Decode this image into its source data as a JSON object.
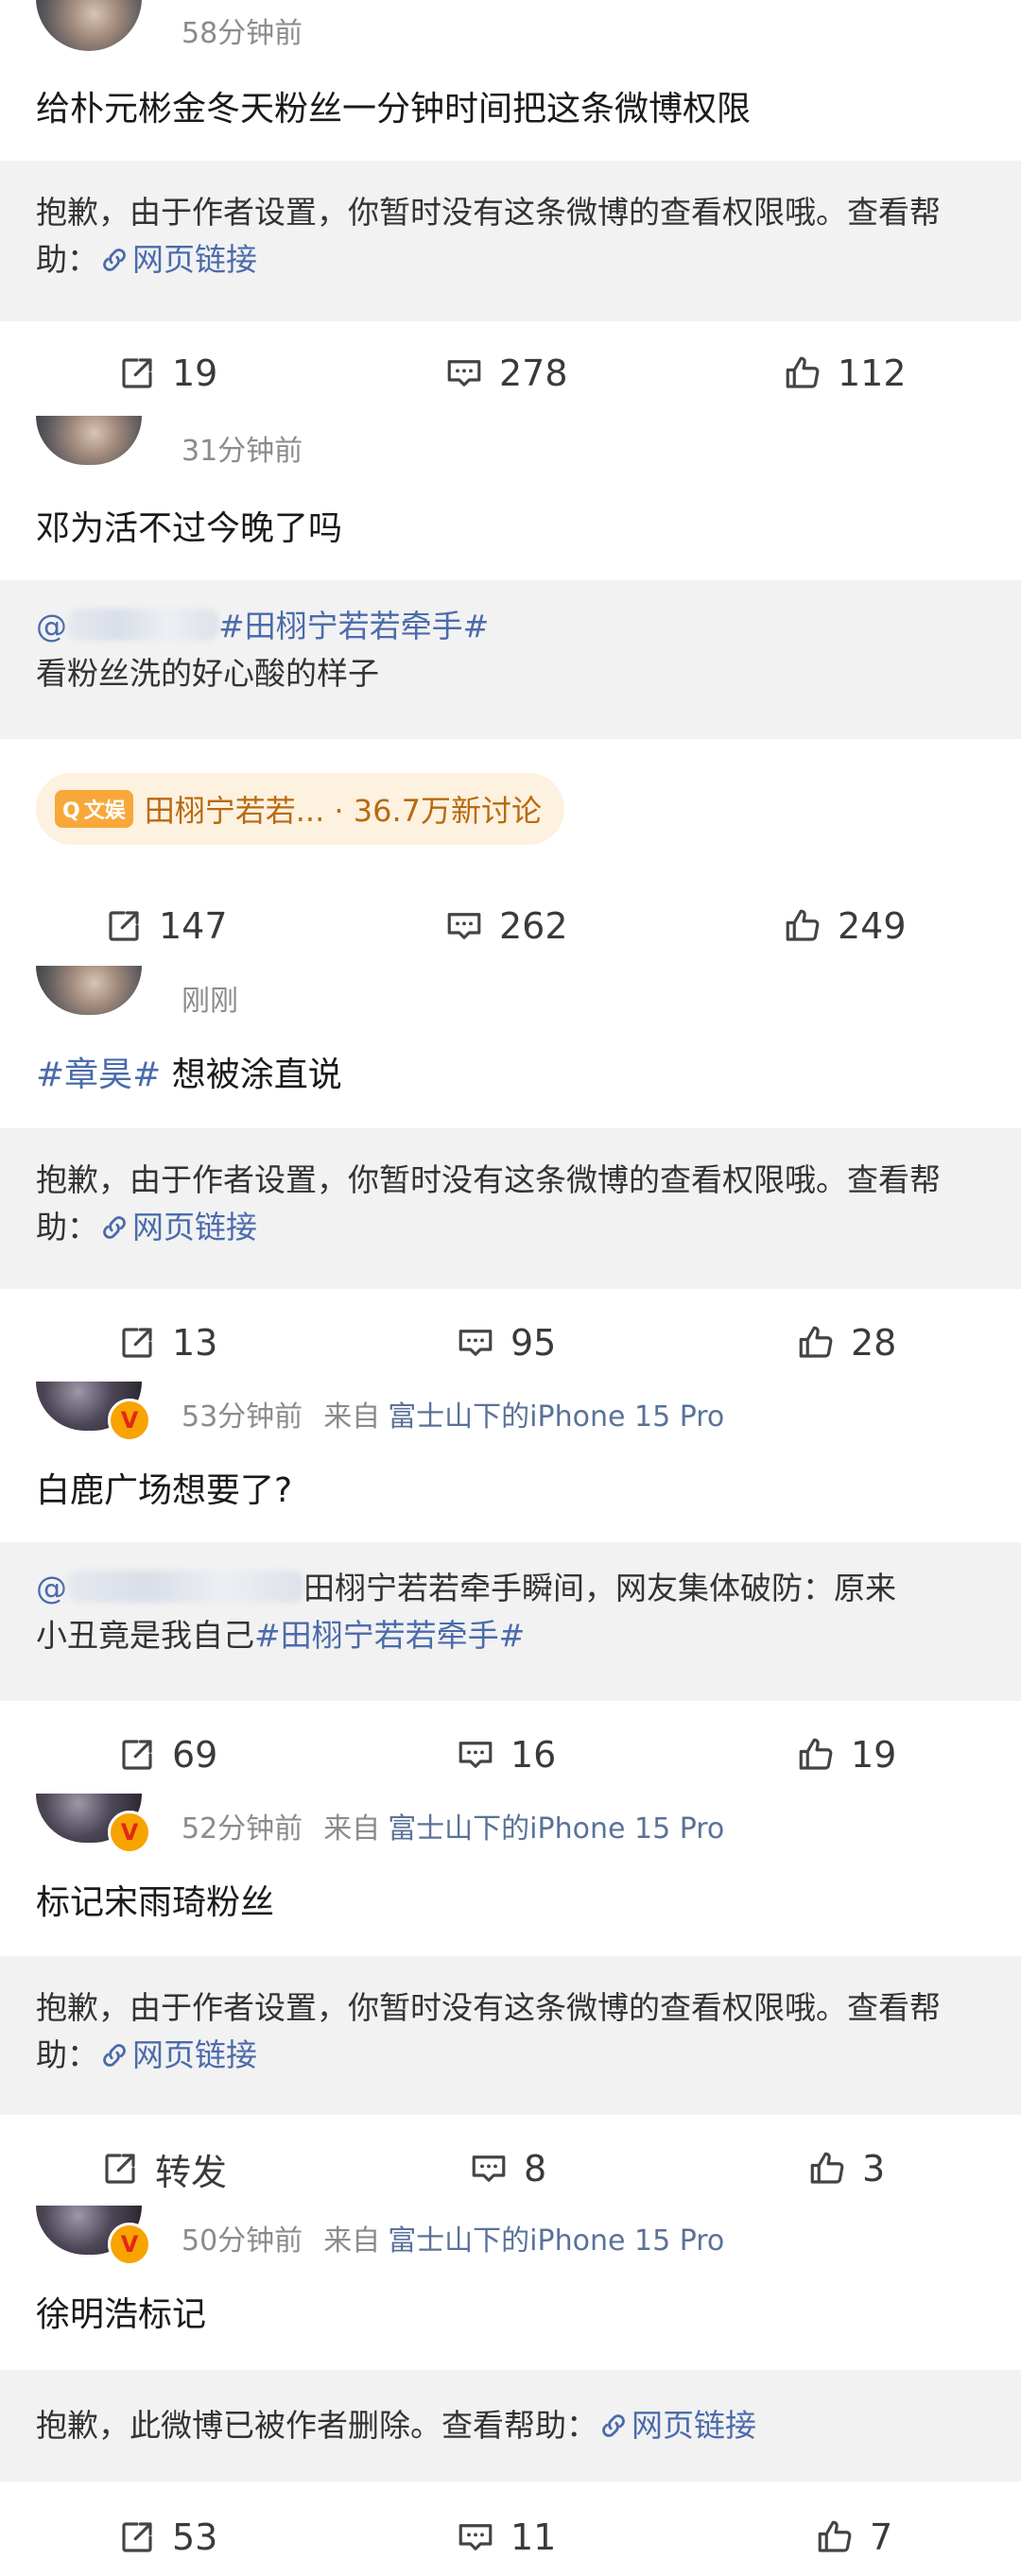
{
  "posts": [
    {
      "time": "58分钟前",
      "source": "",
      "device": "",
      "text": "给朴元彬金冬天粉丝一分钟时间把这条微博权限",
      "notice": "抱歉，由于作者设置，你暂时没有这条微博的查看权限哦。查看帮助：",
      "link_label": "网页链接",
      "repost": "19",
      "comment": "278",
      "like": "112"
    },
    {
      "time": "31分钟前",
      "text": "邓为活不过今晚了吗",
      "quote_prefix": "@",
      "quote_hashtag": "#田栩宁若若牵手#",
      "quote_text": "看粉丝洗的好心酸的样子",
      "topic_badge": "文娱",
      "topic_label": "田栩宁若若... · 36.7万新讨论",
      "repost": "147",
      "comment": "262",
      "like": "249"
    },
    {
      "time": "刚刚",
      "hashtag": "#章昊#",
      "text": " 想被涂直说",
      "notice": "抱歉，由于作者设置，你暂时没有这条微博的查看权限哦。查看帮助：",
      "link_label": "网页链接",
      "repost": "13",
      "comment": "95",
      "like": "28"
    },
    {
      "time": "53分钟前",
      "source": "来自",
      "device": "富士山下的iPhone 15 Pro",
      "text": "白鹿广场想要了?",
      "quote_prefix": "@",
      "quote_line1": "田栩宁若若牵手瞬间，网友集体破防：原来",
      "quote_line2": "小丑竟是我自己",
      "quote_hashtag": "#田栩宁若若牵手#",
      "repost": "69",
      "comment": "16",
      "like": "19"
    },
    {
      "time": "52分钟前",
      "source": "来自",
      "device": "富士山下的iPhone 15 Pro",
      "text": "标记宋雨琦粉丝",
      "notice": "抱歉，由于作者设置，你暂时没有这条微博的查看权限哦。查看帮助：",
      "link_label": "网页链接",
      "repost": "转发",
      "comment": "8",
      "like": "3"
    },
    {
      "time": "50分钟前",
      "source": "来自",
      "device": "富士山下的iPhone 15 Pro",
      "text": "徐明浩标记",
      "notice": "抱歉，此微博已被作者删除。查看帮助：",
      "link_label": "网页链接",
      "repost": "53",
      "comment": "11",
      "like": "7"
    }
  ],
  "icons": {
    "repost": "share-icon",
    "comment": "comment-icon",
    "like": "thumbs-up-icon",
    "link": "link-icon",
    "verified": "verified-badge-icon"
  },
  "colors": {
    "link": "#4b6bab",
    "meta": "#8b8b8b",
    "notice_bg": "#f2f2f2",
    "topic_bg": "#fdf1df",
    "topic_text": "#b86a11",
    "badge": "#f7a400"
  }
}
